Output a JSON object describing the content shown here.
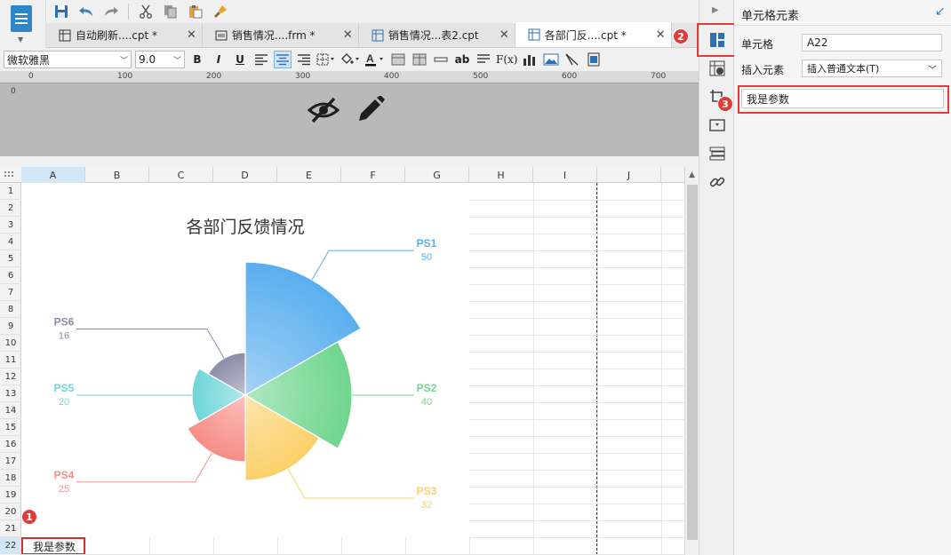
{
  "tabs": [
    {
      "label": "自动刷新....cpt *",
      "active": false
    },
    {
      "label": "销售情况....frm *",
      "active": false
    },
    {
      "label": "销售情况...表2.cpt",
      "active": false
    },
    {
      "label": "各部门反....cpt *",
      "active": true
    }
  ],
  "format_toolbar": {
    "font_name": "微软雅黑",
    "font_size": "9.0",
    "bold": "B",
    "italic": "I",
    "underline": "U",
    "text_style": "ab",
    "formula": "F(x)"
  },
  "ruler": {
    "labels": [
      "0",
      "100",
      "200",
      "300",
      "400",
      "500",
      "600",
      "700"
    ],
    "side_label": "0"
  },
  "grid": {
    "columns": [
      "A",
      "B",
      "C",
      "D",
      "E",
      "F",
      "G",
      "H",
      "I",
      "J"
    ],
    "selected_column": "A",
    "rows": [
      "1",
      "2",
      "3",
      "4",
      "5",
      "6",
      "7",
      "8",
      "9",
      "10",
      "11",
      "12",
      "13",
      "14",
      "15",
      "16",
      "17",
      "18",
      "19",
      "20",
      "21",
      "22"
    ],
    "selected_row": "22",
    "selected_cell_value": "我是参数"
  },
  "chart_data": {
    "type": "pie",
    "variant": "rose",
    "title": "各部门反馈情况",
    "categories": [
      "PS1",
      "PS2",
      "PS3",
      "PS4",
      "PS5",
      "PS6"
    ],
    "values": [
      50,
      40,
      32,
      25,
      20,
      16
    ],
    "colors": [
      "#5aaeee",
      "#6fd58e",
      "#fbd06a",
      "#f68d86",
      "#6fd6d8",
      "#8c8ca8"
    ],
    "legend": "none"
  },
  "panel": {
    "title": "单元格元素",
    "cell_label": "单元格",
    "cell_value": "A22",
    "insert_label": "插入元素",
    "insert_value": "插入普通文本(T)",
    "text_value": "我是参数"
  },
  "badges": {
    "one": "1",
    "two": "2",
    "three": "3"
  }
}
